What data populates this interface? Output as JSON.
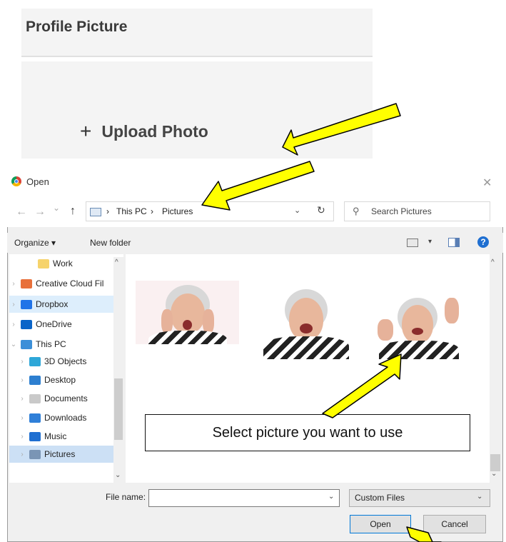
{
  "profile": {
    "title": "Profile Picture",
    "upload_label": "Upload Photo",
    "plus_glyph": "+"
  },
  "dialog": {
    "title": "Open",
    "close_glyph": "✕",
    "nav_glyphs": {
      "back": "←",
      "forward": "→",
      "recent": "⌄",
      "up": "↑",
      "refresh": "↻",
      "search": "⚲",
      "dropdown": "⌄"
    },
    "breadcrumb": [
      "This PC",
      "Pictures"
    ],
    "crumb_sep": "›",
    "search_placeholder": "Search Pictures",
    "toolbar": {
      "organize": "Organize ▾",
      "new_folder": "New folder",
      "view_dd": "▾",
      "help": "?"
    },
    "nav_items": [
      {
        "label": "Work",
        "icon": "folder-icon",
        "color": "#f6d36b",
        "chev": ""
      },
      {
        "label": "Creative Cloud Fil",
        "icon": "creative-cloud-icon",
        "color": "#e8703a",
        "chev": "›"
      },
      {
        "label": "Dropbox",
        "icon": "dropbox-icon",
        "color": "#1f73e8",
        "chev": "›"
      },
      {
        "label": "OneDrive",
        "icon": "onedrive-icon",
        "color": "#0a64c8",
        "chev": "›"
      },
      {
        "label": "This PC",
        "icon": "computer-icon",
        "color": "#3c8fd8",
        "chev": "⌄"
      },
      {
        "label": "3D Objects",
        "icon": "3d-objects-icon",
        "color": "#2ea7d8",
        "chev": "›"
      },
      {
        "label": "Desktop",
        "icon": "desktop-icon",
        "color": "#2d7fd0",
        "chev": "›"
      },
      {
        "label": "Documents",
        "icon": "documents-icon",
        "color": "#c9c9c9",
        "chev": "›"
      },
      {
        "label": "Downloads",
        "icon": "downloads-icon",
        "color": "#2f7fd8",
        "chev": "›"
      },
      {
        "label": "Music",
        "icon": "music-icon",
        "color": "#1f6fd1",
        "chev": "›"
      },
      {
        "label": "Pictures",
        "icon": "pictures-icon",
        "color": "#7a95b5",
        "chev": "›"
      }
    ],
    "scroll_glyphs": {
      "up": "^",
      "down": "⌄"
    },
    "file_name_label": "File name:",
    "file_name_value": "",
    "file_type": "Custom Files",
    "open_label": "Open",
    "cancel_label": "Cancel"
  },
  "callout": "Select picture you want to use",
  "colors": {
    "arrow_fill": "#ffff00",
    "arrow_stroke": "#000000",
    "accent": "#0078d7"
  }
}
